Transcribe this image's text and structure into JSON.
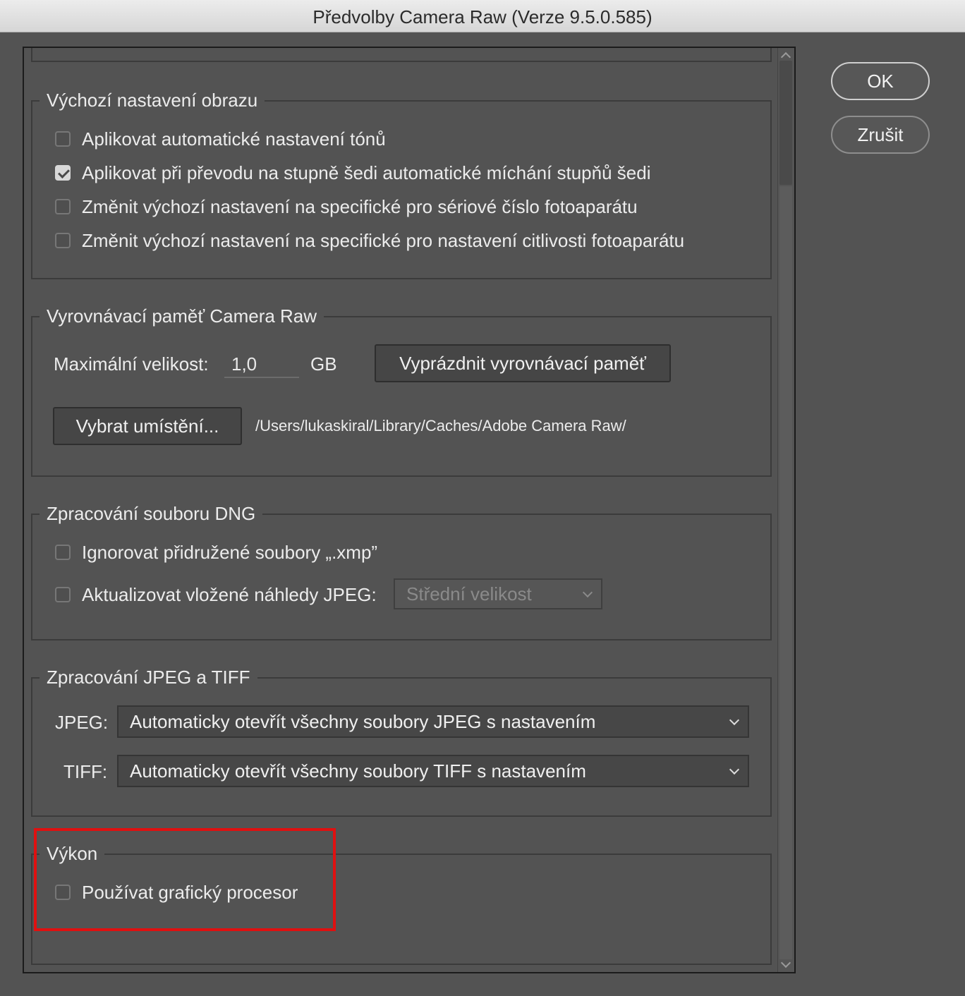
{
  "window": {
    "title": "Předvolby Camera Raw  (Verze 9.5.0.585)"
  },
  "buttons": {
    "ok": "OK",
    "cancel": "Zrušit"
  },
  "image_defaults": {
    "title": "Výchozí nastavení obrazu",
    "options": [
      {
        "label": "Aplikovat automatické nastavení tónů",
        "checked": false
      },
      {
        "label": "Aplikovat při převodu na stupně šedi automatické míchání stupňů šedi",
        "checked": true
      },
      {
        "label": "Změnit výchozí nastavení na specifické pro sériové číslo fotoaparátu",
        "checked": false
      },
      {
        "label": "Změnit výchozí nastavení na specifické pro nastavení citlivosti fotoaparátu",
        "checked": false
      }
    ]
  },
  "cache": {
    "title": "Vyrovnávací paměť Camera Raw",
    "max_size_label": "Maximální velikost:",
    "max_size_value": "1,0",
    "unit": "GB",
    "purge_button": "Vyprázdnit vyrovnávací paměť",
    "select_location_button": "Vybrat umístění...",
    "path": "/Users/lukaskiral/Library/Caches/Adobe Camera Raw/"
  },
  "dng": {
    "title": "Zpracování souboru DNG",
    "ignore_xmp": {
      "label": "Ignorovat přidružené soubory „.xmp”",
      "checked": false
    },
    "update_previews": {
      "label": "Aktualizovat vložené náhledy JPEG:",
      "checked": false
    },
    "preview_size": "Střední velikost"
  },
  "jpeg_tiff": {
    "title": "Zpracování JPEG a TIFF",
    "jpeg_label": "JPEG:",
    "jpeg_value": "Automaticky otevřít všechny soubory JPEG s nastavením",
    "tiff_label": "TIFF:",
    "tiff_value": "Automaticky otevřít všechny soubory TIFF s nastavením"
  },
  "performance": {
    "title": "Výkon",
    "use_gpu": {
      "label": "Používat grafický procesor",
      "checked": false
    }
  },
  "colors": {
    "highlight": "#e01010",
    "background": "#535353"
  }
}
